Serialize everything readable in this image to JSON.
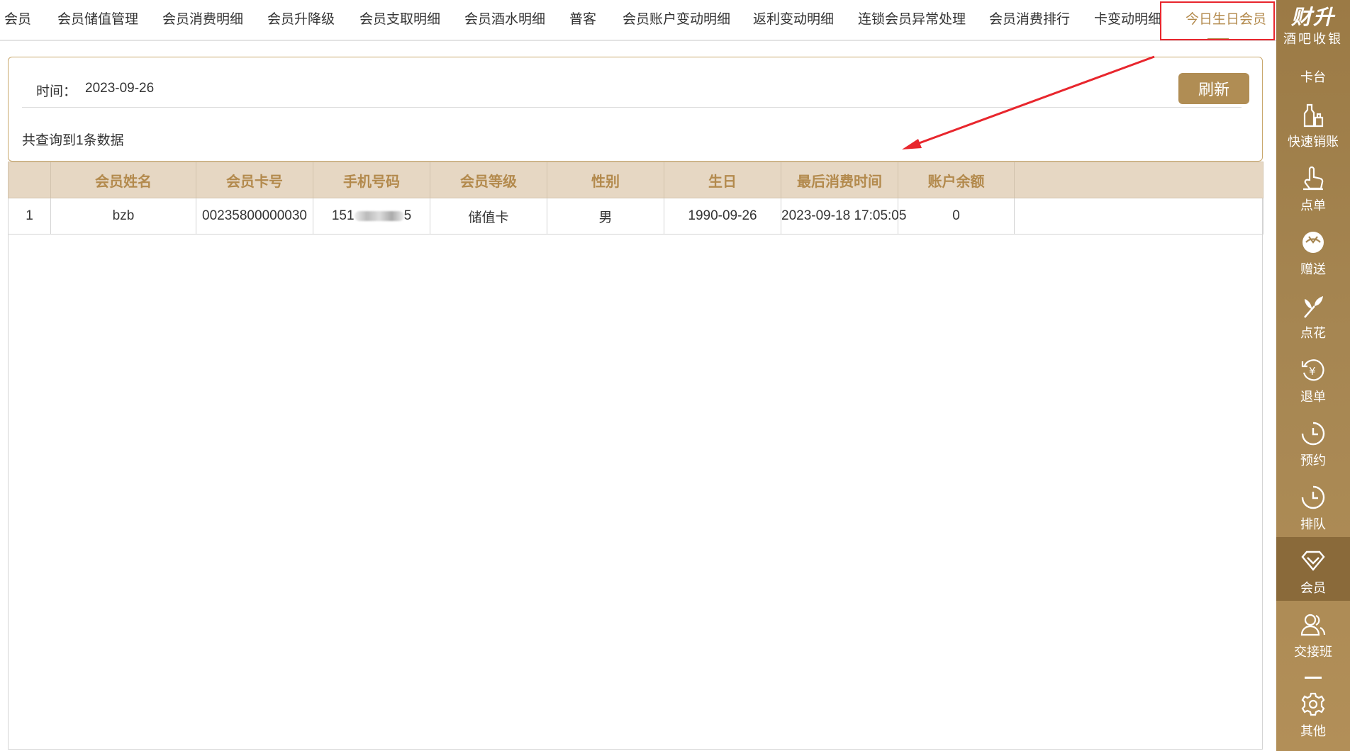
{
  "tabs": [
    {
      "label": "会员"
    },
    {
      "label": "会员储值管理"
    },
    {
      "label": "会员消费明细"
    },
    {
      "label": "会员升降级"
    },
    {
      "label": "会员支取明细"
    },
    {
      "label": "会员酒水明细"
    },
    {
      "label": "普客"
    },
    {
      "label": "会员账户变动明细"
    },
    {
      "label": "返利变动明细"
    },
    {
      "label": "连锁会员异常处理"
    },
    {
      "label": "会员消费排行"
    },
    {
      "label": "卡变动明细"
    },
    {
      "label": "今日生日会员",
      "active": true
    }
  ],
  "sidebar": {
    "brand_logo": "财升",
    "brand_sub": "酒吧收银",
    "top_label": "卡台",
    "items": [
      {
        "label": "快速销账",
        "icon": "bottles-icon"
      },
      {
        "label": "点单",
        "icon": "hand-pointer-icon"
      },
      {
        "label": "赠送",
        "icon": "gift-icon"
      },
      {
        "label": "点花",
        "icon": "flower-icon"
      },
      {
        "label": "退单",
        "icon": "refund-yen-icon"
      },
      {
        "label": "预约",
        "icon": "clock-icon"
      },
      {
        "label": "排队",
        "icon": "clock-icon"
      },
      {
        "label": "会员",
        "icon": "diamond-icon",
        "active": true
      },
      {
        "label": "交接班",
        "icon": "users-icon"
      },
      {
        "label": "其他",
        "icon": "gear-icon"
      }
    ]
  },
  "filter": {
    "time_label": "时间：",
    "time_value": "2023-09-26",
    "refresh_label": "刷新",
    "count_text": "共查询到1条数据"
  },
  "table": {
    "columns": [
      "",
      "会员姓名",
      "会员卡号",
      "手机号码",
      "会员等级",
      "性别",
      "生日",
      "最后消费时间",
      "账户余额",
      ""
    ],
    "rows": [
      {
        "index": "1",
        "name": "bzb",
        "card_no": "00235800000030",
        "phone_prefix": "151",
        "phone_suffix": "5",
        "level": "储值卡",
        "gender": "男",
        "birthday": "1990-09-26",
        "last_consume": "2023-09-18 17:05:05",
        "balance": "0"
      }
    ]
  },
  "colors": {
    "accent": "#b08d54",
    "header_bg": "#e6d7c3",
    "annotation_red": "#e8262d"
  }
}
